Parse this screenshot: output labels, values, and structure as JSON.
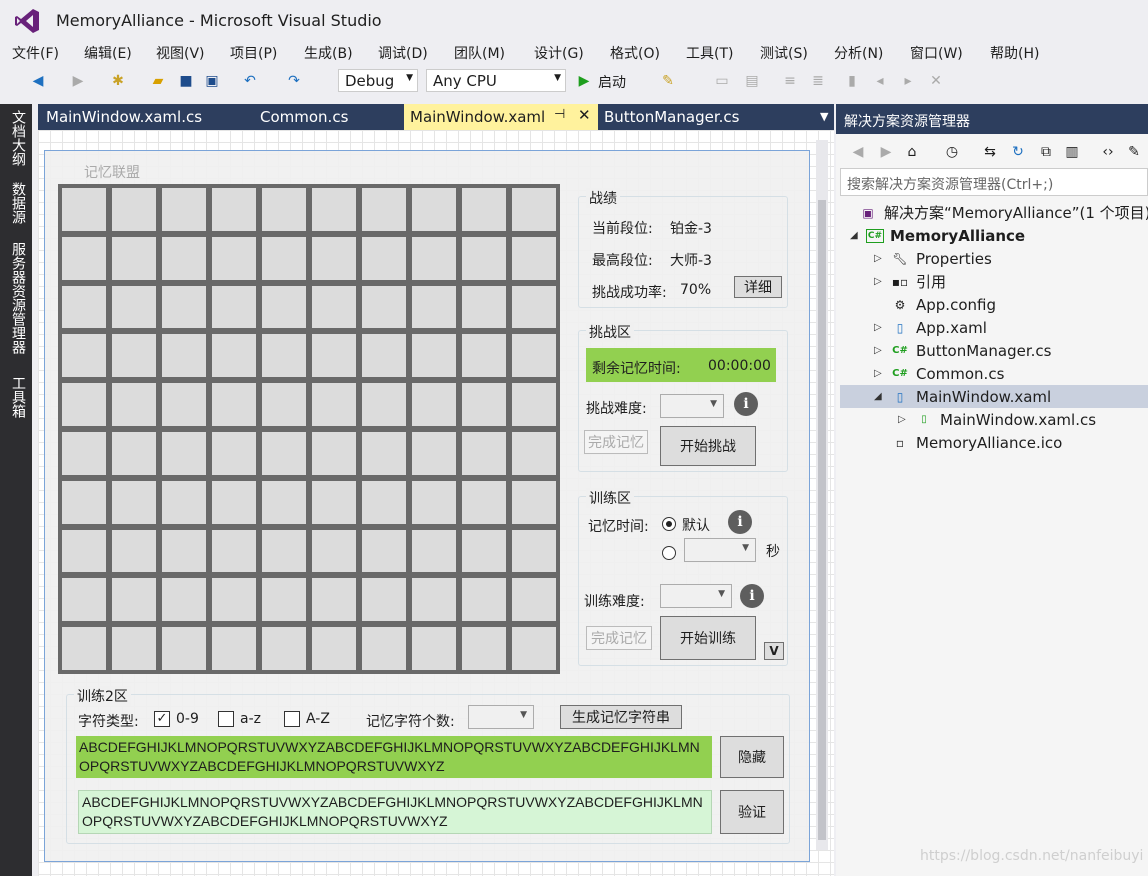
{
  "window": {
    "title": "MemoryAlliance - Microsoft Visual Studio"
  },
  "menu": [
    "文件(F)",
    "编辑(E)",
    "视图(V)",
    "项目(P)",
    "生成(B)",
    "调试(D)",
    "团队(M)",
    "设计(G)",
    "格式(O)",
    "工具(T)",
    "测试(S)",
    "分析(N)",
    "窗口(W)",
    "帮助(H)"
  ],
  "toolbar": {
    "config": "Debug",
    "platform": "Any CPU",
    "start_label": "启动"
  },
  "side_tabs": [
    "文档大纲",
    "数据源",
    "服务器资源管理器",
    "工具箱"
  ],
  "doc_tabs": [
    "MainWindow.xaml.cs",
    "Common.cs",
    "MainWindow.xaml",
    "ButtonManager.cs"
  ],
  "app": {
    "title": "记忆联盟",
    "stats": {
      "title": "战绩",
      "current_rank_label": "当前段位:",
      "current_rank": "铂金-3",
      "best_rank_label": "最高段位:",
      "best_rank": "大师-3",
      "rate_label": "挑战成功率:",
      "rate": "70%",
      "detail_btn": "详细"
    },
    "challenge": {
      "title": "挑战区",
      "time_label": "剩余记忆时间:",
      "time": "00:00:00",
      "difficulty_label": "挑战难度:",
      "done_btn": "完成记忆",
      "start_btn": "开始挑战",
      "info": "i"
    },
    "training": {
      "title": "训练区",
      "time_label": "记忆时间:",
      "default_label": "默认",
      "seconds_label": "秒",
      "difficulty_label": "训练难度:",
      "done_btn": "完成记忆",
      "start_btn": "开始训练",
      "v_btn": "V",
      "info": "i"
    },
    "training2": {
      "title": "训练2区",
      "char_type_label": "字符类型:",
      "opt_digits": "0-9",
      "opt_lower": "a-z",
      "opt_upper": "A-Z",
      "count_label": "记忆字符个数:",
      "generate_btn": "生成记忆字符串",
      "text1": "ABCDEFGHIJKLMNOPQRSTUVWXYZABCDEFGHIJKLMNOPQRSTUVWXYZABCDEFGHIJKLMNOPQRSTUVWXYZABCDEFGHIJKLMNOPQRSTUVWXYZ",
      "text2": "ABCDEFGHIJKLMNOPQRSTUVWXYZABCDEFGHIJKLMNOPQRSTUVWXYZABCDEFGHIJKLMNOPQRSTUVWXYZABCDEFGHIJKLMNOPQRSTUVWXYZ",
      "hide_btn": "隐藏",
      "verify_btn": "验证"
    }
  },
  "solution_explorer": {
    "title": "解决方案资源管理器",
    "search_placeholder": "搜索解决方案资源管理器(Ctrl+;)",
    "items": [
      {
        "label": "解决方案“MemoryAlliance”(1 个项目)",
        "icon": "solution-icon"
      },
      {
        "label": "MemoryAlliance",
        "icon": "csharp-project-icon"
      },
      {
        "label": "Properties",
        "icon": "wrench-icon"
      },
      {
        "label": "引用",
        "icon": "references-icon"
      },
      {
        "label": "App.config",
        "icon": "config-icon"
      },
      {
        "label": "App.xaml",
        "icon": "xaml-icon"
      },
      {
        "label": "ButtonManager.cs",
        "icon": "csharp-file-icon"
      },
      {
        "label": "Common.cs",
        "icon": "csharp-file-icon"
      },
      {
        "label": "MainWindow.xaml",
        "icon": "xaml-icon"
      },
      {
        "label": "MainWindow.xaml.cs",
        "icon": "csharp-file-icon"
      },
      {
        "label": "MemoryAlliance.ico",
        "icon": "ico-file-icon"
      }
    ]
  },
  "watermark": "https://blog.csdn.net/nanfeibuyi",
  "colors": {
    "accent": "#68217a",
    "tab_bar": "#2d3e5e",
    "active_tab": "#fff29d",
    "green": "#92d050",
    "light_green": "#d6f5d6"
  }
}
